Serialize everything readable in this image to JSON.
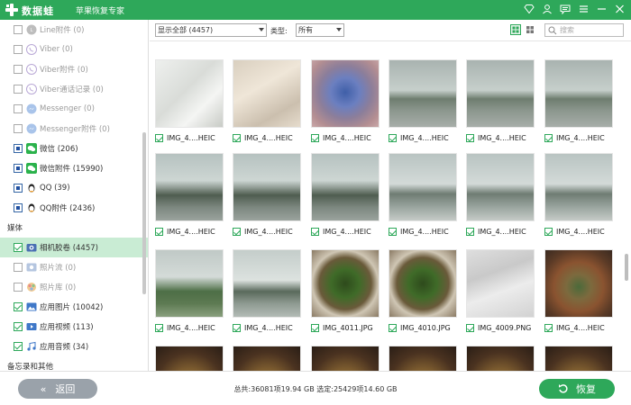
{
  "app": {
    "logo_text": "数据蛙",
    "subtitle": "苹果恢复专家"
  },
  "colors": {
    "accent": "#2ea85a",
    "active_row": "#c9ecd4",
    "back_button": "#9aa2aa"
  },
  "sidebar": {
    "items": [
      {
        "label": "Line附件 (0)",
        "state": "unchecked",
        "icon": "line-icon",
        "dim": true
      },
      {
        "label": "Viber (0)",
        "state": "unchecked",
        "icon": "viber-icon",
        "dim": true
      },
      {
        "label": "Viber附件 (0)",
        "state": "unchecked",
        "icon": "viber-icon",
        "dim": true
      },
      {
        "label": "Viber通话记录 (0)",
        "state": "unchecked",
        "icon": "viber-icon",
        "dim": true
      },
      {
        "label": "Messenger (0)",
        "state": "unchecked",
        "icon": "messenger-icon",
        "dim": true
      },
      {
        "label": "Messenger附件 (0)",
        "state": "unchecked",
        "icon": "messenger-icon",
        "dim": true
      },
      {
        "label": "微信 (206)",
        "state": "partial",
        "icon": "wechat-icon",
        "dim": false
      },
      {
        "label": "微信附件 (15990)",
        "state": "partial",
        "icon": "wechat-icon",
        "dim": false
      },
      {
        "label": "QQ (39)",
        "state": "partial",
        "icon": "qq-icon",
        "dim": false
      },
      {
        "label": "QQ附件 (2436)",
        "state": "partial",
        "icon": "qq-icon",
        "dim": false
      }
    ],
    "media_heading": "媒体",
    "media_items": [
      {
        "label": "相机胶卷 (4457)",
        "state": "checked",
        "icon": "camera-roll-icon",
        "active": true,
        "dim": false
      },
      {
        "label": "照片流 (0)",
        "state": "unchecked",
        "icon": "photo-stream-icon",
        "active": false,
        "dim": true
      },
      {
        "label": "照片库 (0)",
        "state": "unchecked",
        "icon": "photo-library-icon",
        "active": false,
        "dim": true
      },
      {
        "label": "应用图片 (10042)",
        "state": "checked",
        "icon": "app-photos-icon",
        "active": false,
        "dim": false
      },
      {
        "label": "应用视频 (113)",
        "state": "checked",
        "icon": "app-videos-icon",
        "active": false,
        "dim": false
      },
      {
        "label": "应用音频 (34)",
        "state": "checked",
        "icon": "app-audio-icon",
        "active": false,
        "dim": false
      }
    ],
    "other_heading": "备忘录和其他"
  },
  "toolbar": {
    "filter_value": "显示全部 (4457)",
    "type_label": "类型:",
    "type_value": "所有",
    "search_placeholder": "搜索"
  },
  "grid": {
    "rows": [
      [
        {
          "caption": "IMG_4....HEIC",
          "thumb": "white-paper"
        },
        {
          "caption": "IMG_4....HEIC",
          "thumb": "beige-paper"
        },
        {
          "caption": "IMG_4....HEIC",
          "thumb": "blurred-face"
        },
        {
          "caption": "IMG_4....HEIC",
          "thumb": "rainy-road"
        },
        {
          "caption": "IMG_4....HEIC",
          "thumb": "rainy-road"
        },
        {
          "caption": "IMG_4....HEIC",
          "thumb": "rainy-road"
        }
      ],
      [
        {
          "caption": "IMG_4....HEIC",
          "thumb": "palm-rain"
        },
        {
          "caption": "IMG_4....HEIC",
          "thumb": "palm-rain"
        },
        {
          "caption": "IMG_4....HEIC",
          "thumb": "palm-rain"
        },
        {
          "caption": "IMG_4....HEIC",
          "thumb": "road-lines"
        },
        {
          "caption": "IMG_4....HEIC",
          "thumb": "road-lines"
        },
        {
          "caption": "IMG_4....HEIC",
          "thumb": "road-lines"
        }
      ],
      [
        {
          "caption": "IMG_4....HEIC",
          "thumb": "lawn-rain"
        },
        {
          "caption": "IMG_4....HEIC",
          "thumb": "palm-car"
        },
        {
          "caption": "IMG_4011.JPG",
          "thumb": "greens-plate"
        },
        {
          "caption": "IMG_4010.JPG",
          "thumb": "greens-plate"
        },
        {
          "caption": "IMG_4009.PNG",
          "thumb": "blurred-grey"
        },
        {
          "caption": "IMG_4....HEIC",
          "thumb": "clay-pot"
        }
      ],
      [
        {
          "caption": "",
          "thumb": "clay-pot-dark"
        },
        {
          "caption": "",
          "thumb": "clay-pot-dark"
        },
        {
          "caption": "",
          "thumb": "clay-pot-dark"
        },
        {
          "caption": "",
          "thumb": "clay-pot-dark"
        },
        {
          "caption": "",
          "thumb": "clay-pot-dark"
        },
        {
          "caption": "",
          "thumb": "clay-pot-dark"
        }
      ]
    ]
  },
  "bottom": {
    "back_label": "返回",
    "status_text": "总共:36081项19.94 GB 选定:25429项14.60 GB",
    "recover_label": "恢复"
  }
}
